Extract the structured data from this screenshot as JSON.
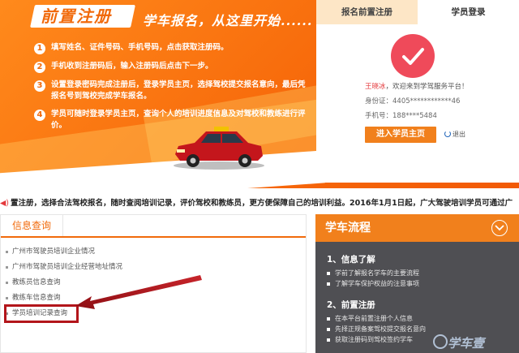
{
  "hero": {
    "title": "前置注册",
    "slogan": "学车报名，从这里开始......",
    "steps": [
      {
        "num": "1",
        "text": "填写姓名、证件号码、手机号码，点击获取注册码。"
      },
      {
        "num": "2",
        "text": "手机收到注册码后，输入注册码后点击下一步。"
      },
      {
        "num": "3",
        "text": "设置登录密码完成注册后，登录学员主页，选择驾校提交报名意向，最后凭报名号到驾校完成学车报名。"
      },
      {
        "num": "4",
        "text": "学员可随时登录学员主页，查询个人的培训进度信息及对驾校和教练进行评价。"
      }
    ]
  },
  "login": {
    "tabs": [
      "报名前置注册",
      "学员登录"
    ],
    "active_tab": 1,
    "user_name": "王晓冰",
    "welcome_suffix": "，欢迎来到学驾服务平台！",
    "id_label": "身份证：",
    "id_value": "4405************46",
    "phone_label": "手机号：",
    "phone_value": "188****5484",
    "enter_button": "进入学员主页",
    "logout_label": "退出"
  },
  "marquee": {
    "icon": "speaker-icon",
    "text": "置注册，选择合法驾校报名，随时查阅培训记录，评价驾校和教练员，更方便保障自己的培训利益。2016年1月1日起，广大驾驶培训学员可通过广"
  },
  "info_query": {
    "title": "信息查询",
    "items": [
      "广州市驾驶员培训企业情况",
      "广州市驾驶员培训企业经营地址情况",
      "教练员信息查询",
      "教练车信息查询",
      "学员培训记录查询"
    ],
    "highlighted_index": 4
  },
  "learn_process": {
    "title": "学车流程",
    "sections": [
      {
        "heading": "1、信息了解",
        "items": [
          "学前了解报名学车的主要流程",
          "了解学车保护权益的注意事项"
        ]
      },
      {
        "heading": "2、前置注册",
        "items": [
          "在本平台前置注册个人信息",
          "先择正规备案驾校提交报名意向",
          "获取注册码到驾校签约学车"
        ]
      }
    ]
  },
  "watermark": "学车壹",
  "colors": {
    "brand_orange": "#f16a0b",
    "button_orange": "#f1801c",
    "check_red": "#ef4a5a",
    "highlight_red": "#b3151b",
    "panel_dark": "#4f4f53"
  }
}
